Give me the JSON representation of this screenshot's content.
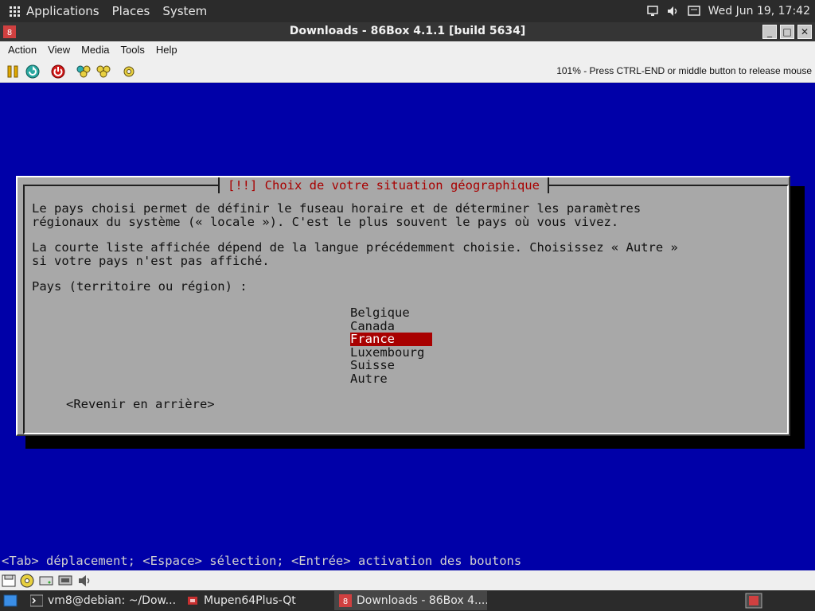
{
  "top_panel": {
    "applications": "Applications",
    "places": "Places",
    "system": "System",
    "clock": "Wed Jun 19, 17:42"
  },
  "window": {
    "title": "Downloads - 86Box 4.1.1 [build 5634]",
    "minimize": "_",
    "maximize": "□",
    "close": "✕"
  },
  "menubar": {
    "items": [
      "Action",
      "View",
      "Media",
      "Tools",
      "Help"
    ]
  },
  "toolbar": {
    "buttons": [
      "pause-icon",
      "reset-icon",
      "power-icon",
      "ctrl-alt-del-icon",
      "ctrl-alt-esc-icon",
      "settings-icon"
    ],
    "status_message": "101% - Press CTRL-END or middle button to release mouse"
  },
  "installer": {
    "dialog_title": "[!!] Choix de votre situation géographique",
    "paragraph1_line1": "Le pays choisi permet de définir le fuseau horaire et de déterminer les paramètres",
    "paragraph1_line2": "régionaux du système (« locale »). C'est le plus souvent le pays où vous vivez.",
    "paragraph2_line1": "La courte liste affichée dépend de la langue précédemment choisie. Choisissez « Autre »",
    "paragraph2_line2": "si votre pays n'est pas affiché.",
    "prompt": "Pays (territoire ou région) :",
    "countries": [
      "Belgique",
      "Canada",
      "France",
      "Luxembourg",
      "Suisse",
      "Autre"
    ],
    "selected_country": "France",
    "back_button": "<Revenir en arrière>",
    "help_line": "<Tab> déplacement; <Espace> sélection; <Entrée> activation des boutons",
    "colors": {
      "background": "#0000a8",
      "dialog": "#a8a8a8",
      "title_text": "#a80000",
      "selection": "#a80000"
    }
  },
  "statusbar": {
    "icons": [
      "floppy-icon",
      "cdrom-icon",
      "hard-disk-icon",
      "network-icon",
      "sound-icon"
    ]
  },
  "taskbar": {
    "tasks": [
      {
        "label": "vm8@debian: ~/Dow...",
        "icon": "terminal-icon",
        "active": false
      },
      {
        "label": "Mupen64Plus-Qt",
        "icon": "mupen-icon",
        "active": false
      },
      {
        "label": "Downloads - 86Box 4....",
        "icon": "86box-icon",
        "active": true
      }
    ]
  }
}
